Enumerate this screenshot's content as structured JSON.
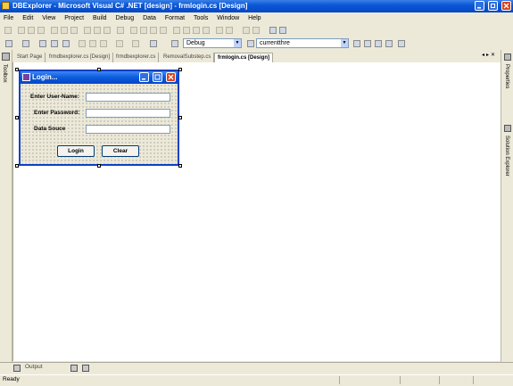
{
  "window": {
    "title": "DBExplorer - Microsoft Visual C# .NET [design] - frmlogin.cs [Design]"
  },
  "menu": [
    "File",
    "Edit",
    "View",
    "Project",
    "Build",
    "Debug",
    "Data",
    "Format",
    "Tools",
    "Window",
    "Help"
  ],
  "toolbar": {
    "config": "Debug",
    "find": "currentthre"
  },
  "toolbox": {
    "label": "Toolbox"
  },
  "tabs": [
    {
      "label": "Start Page"
    },
    {
      "label": "frmdbexplorer.cs [Design]"
    },
    {
      "label": "frmdbexplorer.cs"
    },
    {
      "label": "RemovalSubstep.cs"
    },
    {
      "label": "frmlogin.cs [Design]"
    }
  ],
  "form": {
    "title": "Login...",
    "username_label": "Enter User-Name:",
    "password_label": "Enter Password:",
    "datasource_label": "Data Souce",
    "login_button": "Login",
    "clear_button": "Clear"
  },
  "side_panels": {
    "properties": "Properties",
    "solution_explorer": "Solution Explorer"
  },
  "output": {
    "label": "Output"
  },
  "status": {
    "text": "Ready"
  }
}
